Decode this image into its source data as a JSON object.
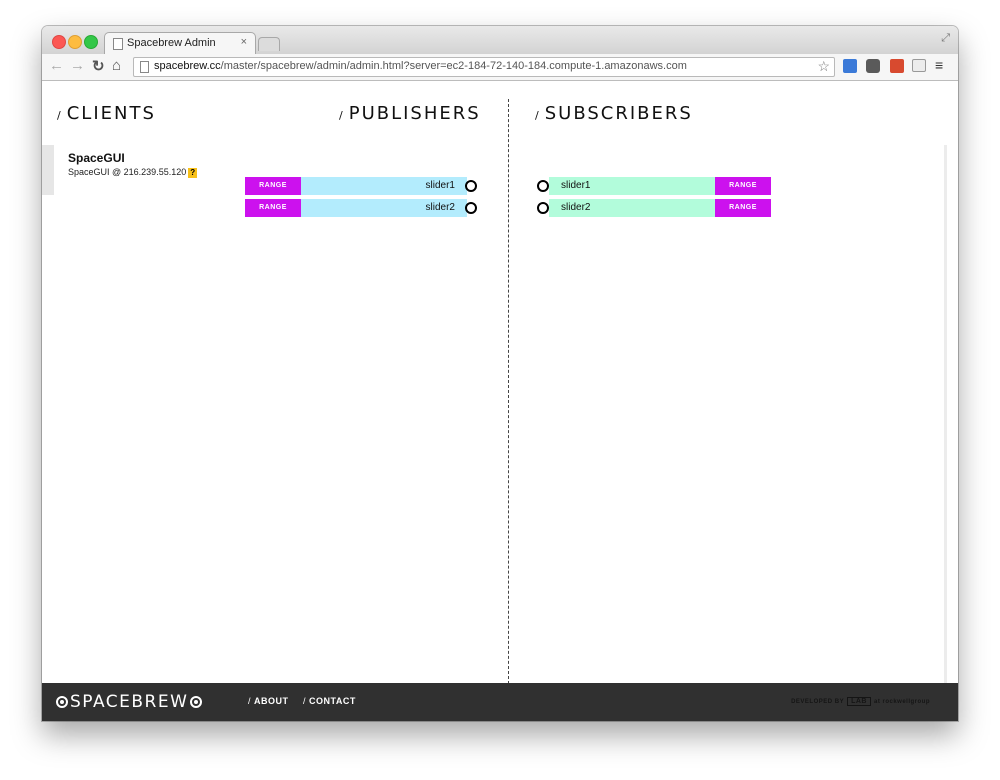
{
  "browser": {
    "tab_title": "Spacebrew Admin",
    "tab_close": "×",
    "url_host": "spacebrew.cc",
    "url_path": "/master/spacebrew/admin/admin.html?server=ec2-184-72-140-184.compute-1.amazonaws.com",
    "star": "☆",
    "menu": "≡",
    "fullscreen": "⤢"
  },
  "sections": {
    "clients": "CLIENTS",
    "publishers": "PUBLISHERS",
    "subscribers": "SUBSCRIBERS",
    "slash": "/"
  },
  "client": {
    "name": "SpaceGUI",
    "description": "SpaceGUI @ 216.239.55.120",
    "help": "?"
  },
  "publishers": [
    {
      "name": "slider1",
      "type": "RANGE"
    },
    {
      "name": "slider2",
      "type": "RANGE"
    }
  ],
  "subscribers": [
    {
      "name": "slider1",
      "type": "RANGE"
    },
    {
      "name": "slider2",
      "type": "RANGE"
    }
  ],
  "footer": {
    "logo": "SPACEBREW",
    "about": "ABOUT",
    "contact": "CONTACT",
    "credit_prefix": "DEVELOPED BY",
    "credit_lab": "LAB",
    "credit_suffix": "at rockwellgroup"
  },
  "colors": {
    "range_badge": "#cc11ee",
    "publisher_row": "#b3ecfd",
    "subscriber_row": "#b2fcdb",
    "footer_bg": "#303030"
  }
}
